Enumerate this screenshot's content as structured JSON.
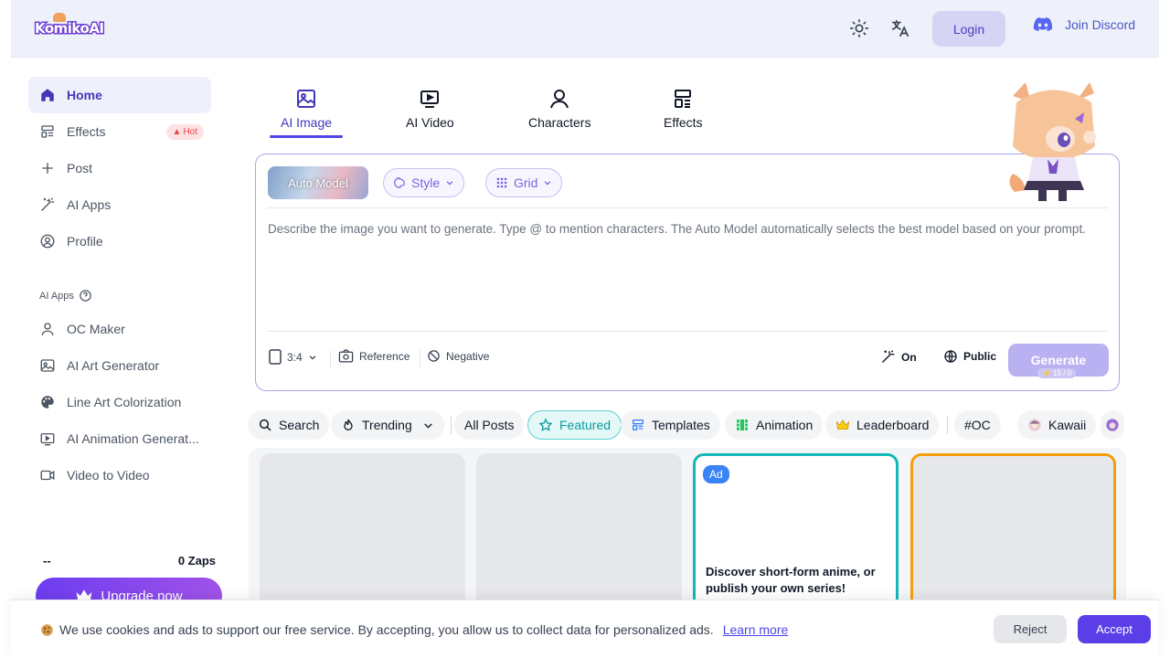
{
  "header": {
    "logo_text": "KomikoAI",
    "theme_icon": "sun-icon",
    "language_icon": "translate-icon",
    "login_label": "Login",
    "discord_label": "Join Discord"
  },
  "sidebar": {
    "items": [
      {
        "label": "Home",
        "icon": "home-icon",
        "active": true
      },
      {
        "label": "Effects",
        "icon": "effects-icon",
        "badge": "Hot"
      },
      {
        "label": "Post",
        "icon": "plus-icon"
      },
      {
        "label": "AI Apps",
        "icon": "magic-wand-icon"
      },
      {
        "label": "Profile",
        "icon": "profile-icon"
      }
    ],
    "section_label": "AI Apps",
    "apps": [
      {
        "label": "OC Maker",
        "icon": "user-icon"
      },
      {
        "label": "AI Art Generator",
        "icon": "image-icon"
      },
      {
        "label": "Line Art Colorization",
        "icon": "palette-icon"
      },
      {
        "label": "AI Animation Generat...",
        "icon": "play-icon"
      },
      {
        "label": "Video to Video",
        "icon": "video-icon"
      }
    ],
    "zaps_left": "--",
    "zaps_right": "0 Zaps",
    "upgrade_label": "Upgrade now"
  },
  "tabs": [
    {
      "label": "AI Image",
      "icon": "image-icon",
      "active": true
    },
    {
      "label": "AI Video",
      "icon": "video-play-icon"
    },
    {
      "label": "Characters",
      "icon": "person-icon"
    },
    {
      "label": "Effects",
      "icon": "layout-icon"
    }
  ],
  "prompt": {
    "model_label": "Auto Model",
    "style_label": "Style",
    "grid_label": "Grid",
    "placeholder": "Describe the image you want to generate. Type @ to mention characters. The Auto Model automatically selects the best model based on your prompt.",
    "ratio_label": "3:4",
    "reference_label": "Reference",
    "negative_label": "Negative",
    "magic_label": "On",
    "visibility_label": "Public",
    "generate_label": "Generate",
    "generate_cost": "15 / 0"
  },
  "filters": {
    "search_label": "Search",
    "trending_label": "Trending",
    "chips": [
      "All Posts",
      "Featured",
      "Templates",
      "Animation",
      "Leaderboard",
      "#OC",
      "Kawaii"
    ],
    "active_chip": "Featured"
  },
  "feed": {
    "ad_badge": "Ad",
    "ad_text": "Discover short-form anime, or publish your own series!"
  },
  "cookie": {
    "text": "We use cookies and ads to support our free service. By accepting, you allow us to collect data for personalized ads.",
    "learn_more": "Learn more",
    "reject_label": "Reject",
    "accept_label": "Accept"
  },
  "colors": {
    "accent": "#4f46e5",
    "featured": "#0e9aa0",
    "ad_border": "#14b8b8",
    "orange_border": "#f59e0b"
  }
}
